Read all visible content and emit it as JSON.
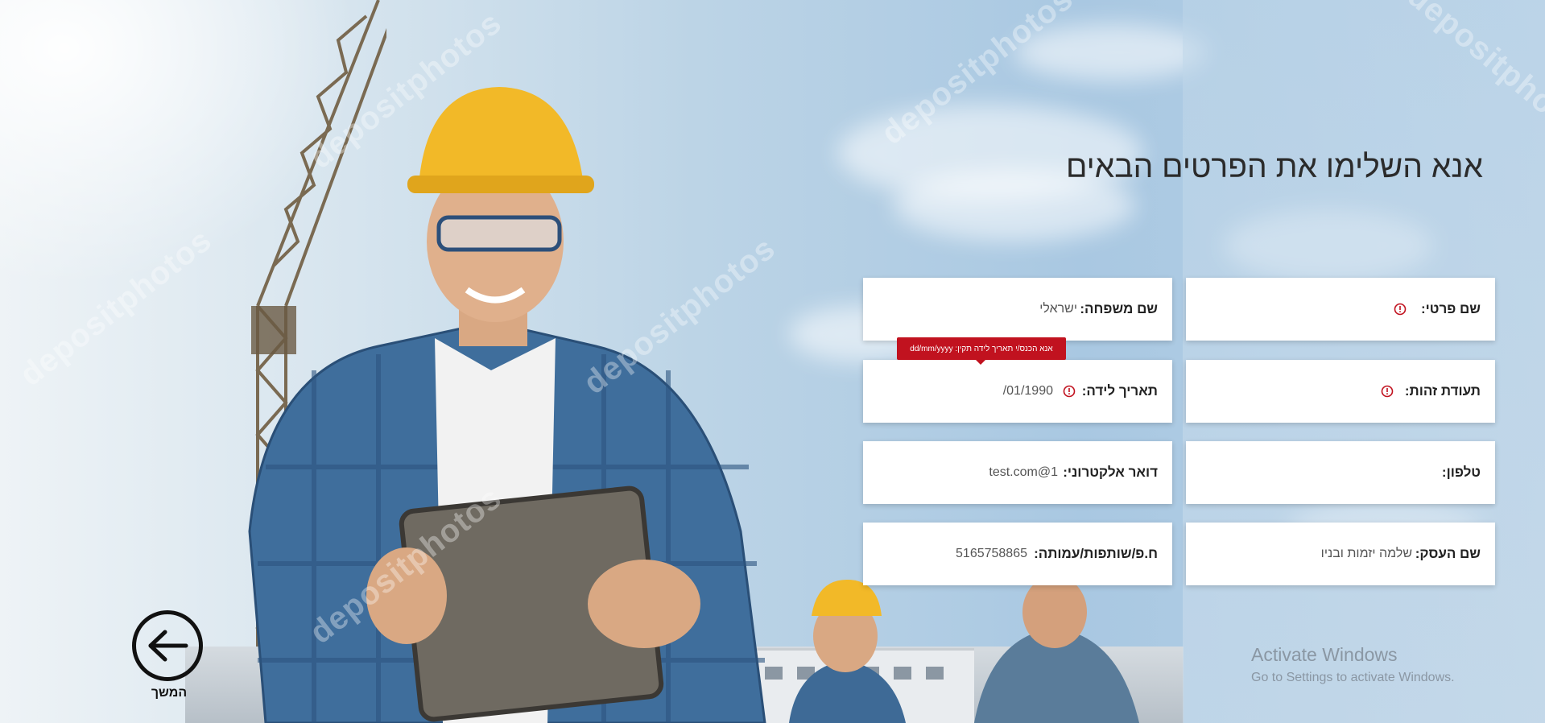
{
  "page": {
    "title": "אנא השלימו את הפרטים הבאים"
  },
  "form": {
    "last_name": {
      "label": "שם משפחה:",
      "value": "ישראלי"
    },
    "first_name": {
      "label": "שם פרטי:",
      "value": ""
    },
    "birth_date": {
      "label": "תאריך לידה:",
      "value": "01/1990/"
    },
    "id_number": {
      "label": "תעודת זהות:",
      "value": ""
    },
    "email": {
      "label": "דואר אלקטרוני:",
      "value": "test.com@1"
    },
    "phone": {
      "label": "טלפון:",
      "value": ""
    },
    "company_id": {
      "label": "ח.פ/שותפות/עמותה:",
      "value": "5165758865"
    },
    "business_name": {
      "label": "שם העסק:",
      "value": "שלמה יזמות ובניו"
    }
  },
  "tooltip": {
    "birth_date_error": "אנא הכנס/י תאריך לידה תקין: dd/mm/yyyy"
  },
  "navigation": {
    "next_label": "המשך"
  },
  "os_overlay": {
    "activate_title": "Activate Windows",
    "activate_subtitle": "Go to Settings to activate Windows."
  },
  "background": {
    "watermark": "depositphotos"
  },
  "colors": {
    "error": "#c1121f",
    "title": "#2b2b2b",
    "field_bg": "#ffffff"
  }
}
